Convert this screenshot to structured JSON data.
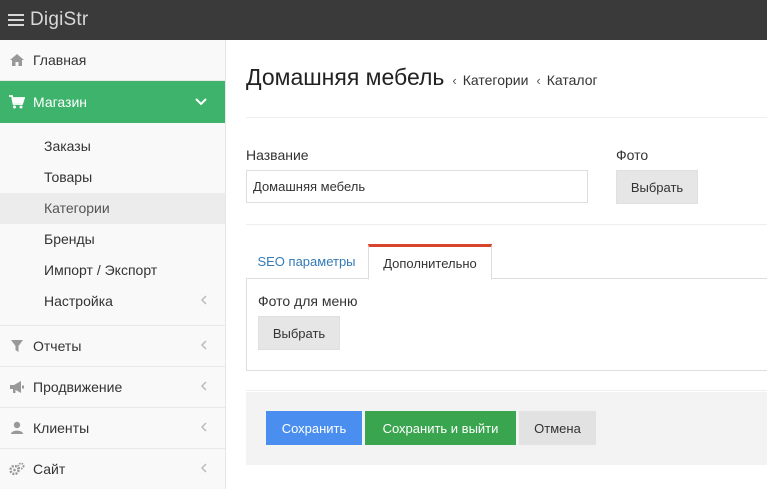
{
  "app": {
    "brand": "DigiStr"
  },
  "sidebar": {
    "items": [
      {
        "label": "Главная",
        "icon": "home-icon"
      },
      {
        "label": "Магазин",
        "icon": "cart-icon",
        "active": true
      },
      {
        "label": "Отчеты",
        "icon": "filter-icon"
      },
      {
        "label": "Продвижение",
        "icon": "megaphone-icon"
      },
      {
        "label": "Клиенты",
        "icon": "user-icon"
      },
      {
        "label": "Сайт",
        "icon": "gears-icon"
      }
    ],
    "shop_sub": [
      {
        "label": "Заказы"
      },
      {
        "label": "Товары"
      },
      {
        "label": "Категории",
        "current": true
      },
      {
        "label": "Бренды"
      },
      {
        "label": "Импорт / Экспорт"
      },
      {
        "label": "Настройка"
      }
    ]
  },
  "header": {
    "title": "Домашняя мебель",
    "breadcrumbs": [
      "Категории",
      "Каталог"
    ]
  },
  "form": {
    "name_label": "Название",
    "name_value": "Домашняя мебель",
    "photo_label": "Фото",
    "photo_button": "Выбрать"
  },
  "tabs": {
    "seo": "SEO параметры",
    "extra": "Дополнительно",
    "active": "extra"
  },
  "extra_panel": {
    "menu_photo_label": "Фото для меню",
    "menu_photo_button": "Выбрать"
  },
  "actions": {
    "save": "Сохранить",
    "save_exit": "Сохранить и выйти",
    "cancel": "Отмена"
  },
  "colors": {
    "topbar": "#3a3a3a",
    "active_nav": "#3db36b",
    "save": "#4a8ff0",
    "save_exit": "#3aa54f",
    "tab_accent": "#d9442c"
  }
}
